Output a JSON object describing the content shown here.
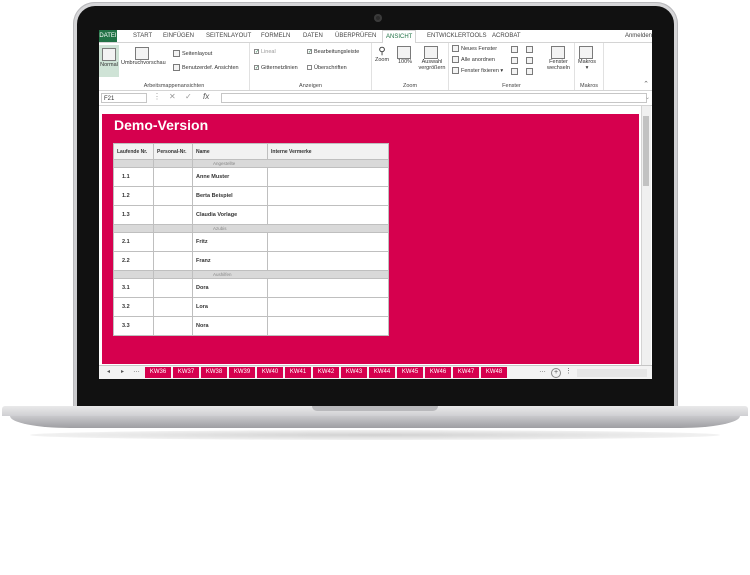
{
  "ribbon_tabs": [
    {
      "label": "DATEI"
    },
    {
      "label": "START"
    },
    {
      "label": "EINFÜGEN"
    },
    {
      "label": "SEITENLAYOUT"
    },
    {
      "label": "FORMELN"
    },
    {
      "label": "DATEN"
    },
    {
      "label": "ÜBERPRÜFEN"
    },
    {
      "label": "ANSICHT"
    },
    {
      "label": "ENTWICKLERTOOLS"
    },
    {
      "label": "ACROBAT"
    }
  ],
  "signin": "Anmelden",
  "ribbon": {
    "views": {
      "normal": "Normal",
      "pagebreak": "Umbruchvorschau",
      "pagelayout": "Seitenlayout",
      "custom": "Benutzerdef. Ansichten",
      "label": "Arbeitsmappenansichten"
    },
    "show": {
      "ruler": "Lineal",
      "formulabar": "Bearbeitungsleiste",
      "gridlines": "Gitternetzlinien",
      "headings": "Überschriften",
      "label": "Anzeigen"
    },
    "zoom": {
      "zoom": "Zoom",
      "hundred": "100%",
      "selection": "Auswahl vergrößern",
      "label": "Zoom"
    },
    "window": {
      "new": "Neues Fenster",
      "arrange": "Alle anordnen",
      "freeze": "Fenster fixieren",
      "switch": "Fenster wechseln",
      "label": "Fenster"
    },
    "macros": {
      "macros": "Makros",
      "label": "Makros"
    }
  },
  "formula": {
    "namebox": "F21",
    "fx": "fx"
  },
  "sheet": {
    "title": "Demo-Version",
    "headers": [
      "Laufende Nr.",
      "Personal-Nr.",
      "Name",
      "Interne Vermerke"
    ],
    "sections": [
      {
        "name": "Angestellte",
        "rows": [
          {
            "nr": "1.1",
            "name": "Anne Muster"
          },
          {
            "nr": "1.2",
            "name": "Berta Beispiel"
          },
          {
            "nr": "1.3",
            "name": "Claudia Vorlage"
          }
        ]
      },
      {
        "name": "Azubis",
        "rows": [
          {
            "nr": "2.1",
            "name": "Fritz"
          },
          {
            "nr": "2.2",
            "name": "Franz"
          }
        ]
      },
      {
        "name": "Aushilfen",
        "rows": [
          {
            "nr": "3.1",
            "name": "Dora"
          },
          {
            "nr": "3.2",
            "name": "Lora"
          },
          {
            "nr": "3.3",
            "name": "Nora"
          }
        ]
      }
    ]
  },
  "sheet_tabs": [
    "KW36",
    "KW37",
    "KW38",
    "KW39",
    "KW40",
    "KW41",
    "KW42",
    "KW43",
    "KW44",
    "KW45",
    "KW46",
    "KW47",
    "KW48"
  ],
  "colors": {
    "accent": "#217346",
    "brand": "#d6004e"
  }
}
